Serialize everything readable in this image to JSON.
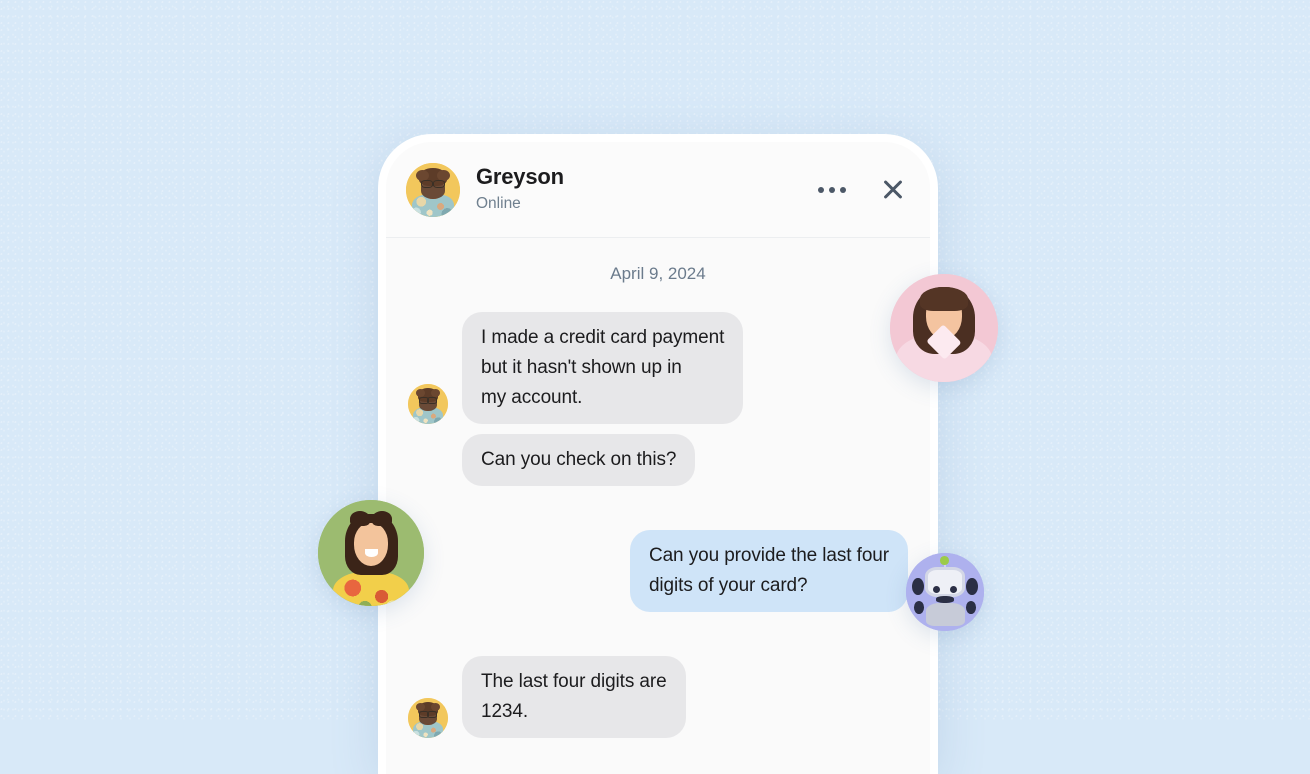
{
  "background": {
    "color": "#d8e9f8"
  },
  "phone": {
    "screen_bg": "#fafafa"
  },
  "header": {
    "avatar": "man-curly-hair-glasses-avatar",
    "contact_name": "Greyson",
    "status": "Online",
    "more_icon": "more-horizontal-icon",
    "close_icon": "close-icon"
  },
  "conversation": {
    "date_divider": "April 9, 2024",
    "messages": [
      {
        "direction": "in",
        "text": "I made a credit card payment\nbut it hasn't shown up in\nmy account.",
        "show_avatar": true,
        "bubble_color": "#e7e7e9"
      },
      {
        "direction": "in",
        "text": "Can you check on this?",
        "show_avatar": false,
        "bubble_color": "#e7e7e9"
      },
      {
        "direction": "out",
        "text": "Can you provide the last four\ndigits of your card?",
        "show_avatar": false,
        "bubble_color": "#cfe4f8"
      },
      {
        "direction": "in",
        "text": "The last four digits are\n1234.",
        "show_avatar": true,
        "bubble_color": "#e7e7e9"
      }
    ]
  },
  "floating_avatars": [
    {
      "name": "woman-pink-avatar",
      "bg": "#f3c8d4"
    },
    {
      "name": "woman-green-avatar",
      "bg": "#9cbb70"
    },
    {
      "name": "chat-bot-avatar",
      "bg": "#aeb1ee"
    }
  ]
}
